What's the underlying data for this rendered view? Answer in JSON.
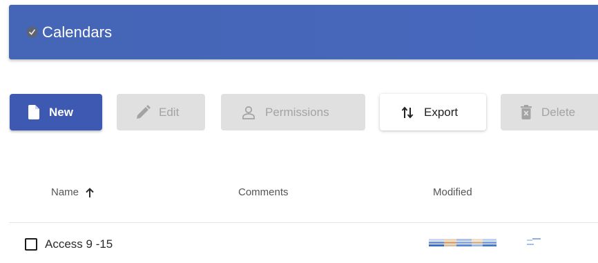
{
  "header": {
    "title": "Calendars",
    "icon": "clock-check-icon"
  },
  "toolbar": {
    "new_label": "New",
    "edit_label": "Edit",
    "permissions_label": "Permissions",
    "export_label": "Export",
    "delete_label": "Delete"
  },
  "table": {
    "columns": [
      "Name",
      "Comments",
      "Modified"
    ],
    "sort": "ascending",
    "rows": [
      {
        "name": "Access 9 -15",
        "comments": "",
        "modified": ""
      }
    ]
  },
  "colors": {
    "header_bg": "#4565b6",
    "primary_button": "#3e59b1",
    "disabled_button": "#e0e0e0",
    "disabled_text": "#a3a3a3"
  }
}
